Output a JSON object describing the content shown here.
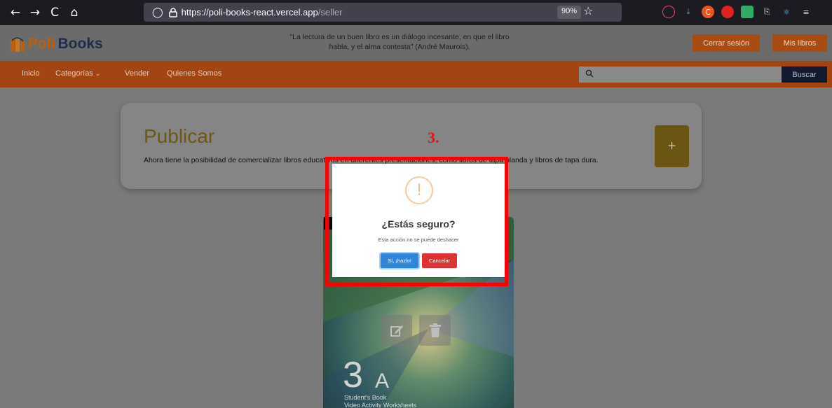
{
  "browser": {
    "back_icon": "←",
    "forward_icon": "→",
    "reload_icon": "C",
    "home_icon": "⌂",
    "shield_icon": "◯",
    "lock_icon": "🔒",
    "url_host": "https://poli-books-react.vercel.app",
    "url_path": "/seller",
    "zoom": "90%",
    "star_icon": "☆"
  },
  "header": {
    "logo_part1": "Poli",
    "logo_part2": "Books",
    "quote_line1": "\"La lectura de un buen libro es un diálogo incesante, en que el libro",
    "quote_line2": "habla, y el alma contesta\" (André Maurois).",
    "logout_label": "Cerrar sesión",
    "my_books_label": "Mis libros"
  },
  "nav": {
    "items": [
      {
        "label": "Inicio"
      },
      {
        "label": "Categorías"
      },
      {
        "label": "Vender"
      },
      {
        "label": "Quienes Somos"
      }
    ],
    "search_placeholder": "",
    "search_button": "Buscar"
  },
  "publish": {
    "title": "Publicar",
    "description": "Ahora tiene la posibilidad de comercializar libros educativos en diferentes presentaciones, como libros de tapa blanda y libros de tapa dura.",
    "plus_label": "+"
  },
  "book": {
    "number": "3",
    "letter": "A",
    "subtitle1": "Student's Book",
    "subtitle2": "Video Activity Worksheets"
  },
  "annotation": {
    "label": "3."
  },
  "modal": {
    "icon": "!",
    "title": "¿Estás seguro?",
    "text": "Esta acción no se puede deshacer",
    "confirm_label": "Sí, ¡hazlo!",
    "cancel_label": "Cancelar"
  },
  "colors": {
    "primary_orange": "#a24513",
    "navy": "#111b30",
    "publish_gold": "#6b5512",
    "confirm_blue": "#3085d6",
    "cancel_red": "#dd3333",
    "annotation_red": "#ff0000"
  }
}
